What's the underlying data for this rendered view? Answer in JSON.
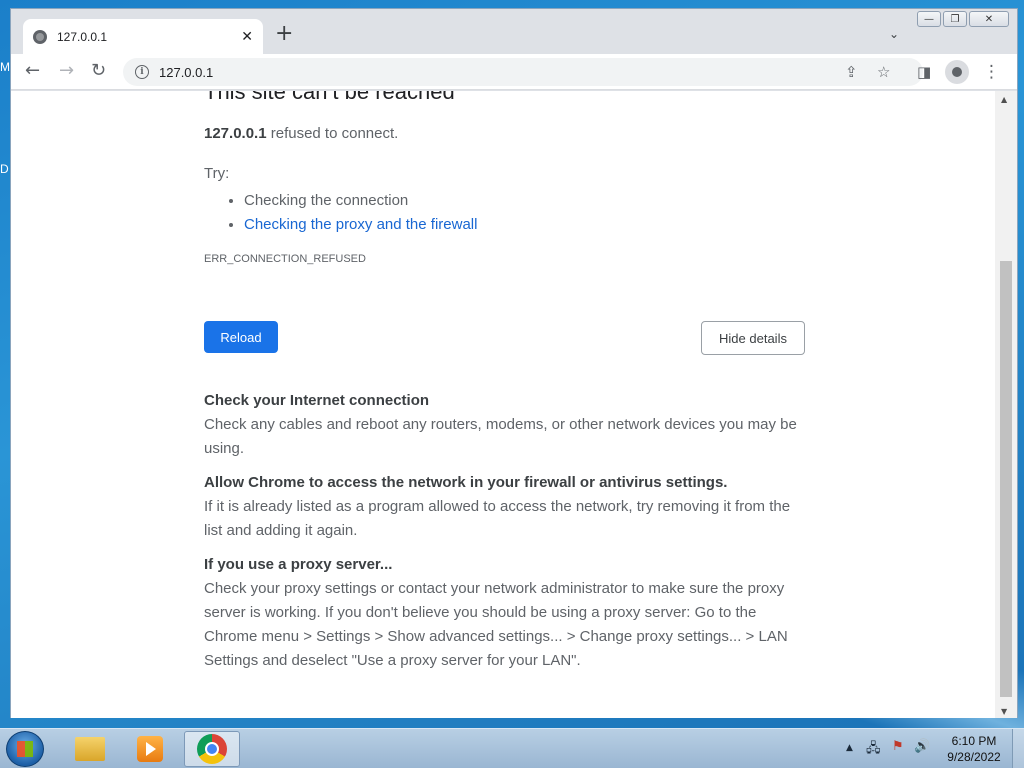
{
  "desktop": {
    "label_m": "M",
    "label_d": "D"
  },
  "window": {
    "controls": {
      "minimize": "—",
      "maximize": "❐",
      "close": "✕"
    }
  },
  "tab": {
    "title": "127.0.0.1",
    "close": "✕",
    "new_tab": "+",
    "tab_list": "⌄"
  },
  "toolbar": {
    "back": "←",
    "forward": "→",
    "reload": "↻",
    "url": "127.0.0.1",
    "share": "⇪",
    "bookmark": "☆",
    "side_panel": "◨",
    "menu": "⋮"
  },
  "page": {
    "headline": "This site can’t be reached",
    "host": "127.0.0.1",
    "refused_text": "refused to connect.",
    "try_label": "Try:",
    "suggestions": [
      "Checking the connection",
      "Checking the proxy and the firewall"
    ],
    "error_code": "ERR_CONNECTION_REFUSED",
    "reload_label": "Reload",
    "hide_details_label": "Hide details",
    "details": [
      {
        "title": "Check your Internet connection",
        "body": "Check any cables and reboot any routers, modems, or other network devices you may be using."
      },
      {
        "title": "Allow Chrome to access the network in your firewall or antivirus settings.",
        "body": "If it is already listed as a program allowed to access the network, try removing it from the list and adding it again."
      },
      {
        "title": "If you use a proxy server...",
        "body": "Check your proxy settings or contact your network administrator to make sure the proxy server is working. If you don't believe you should be using a proxy server: Go to the Chrome menu > Settings > Show advanced settings... > Change proxy settings... > LAN Settings and deselect \"Use a proxy server for your LAN\"."
      }
    ]
  },
  "scrollbar": {
    "up": "▲",
    "down": "▼"
  },
  "taskbar": {
    "tray_expand": "▲",
    "tray_network": "🖧",
    "tray_flag": "⚑",
    "tray_volume": "🔊",
    "time": "6:10 PM",
    "date": "9/28/2022"
  },
  "colors": {
    "link": "#1967d2",
    "primary_button": "#1a73e8"
  }
}
